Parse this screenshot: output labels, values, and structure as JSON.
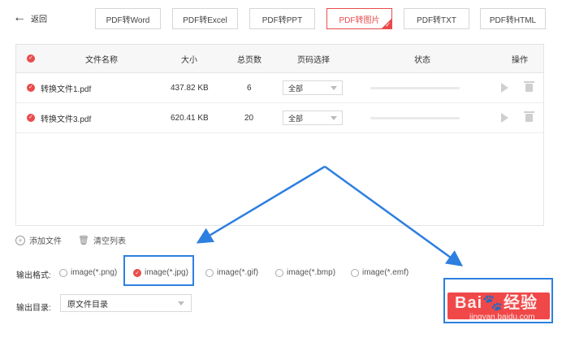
{
  "header": {
    "back_label": "返回",
    "tabs": [
      {
        "label": "PDF转Word",
        "active": false
      },
      {
        "label": "PDF转Excel",
        "active": false
      },
      {
        "label": "PDF转PPT",
        "active": false
      },
      {
        "label": "PDF转图片",
        "active": true
      },
      {
        "label": "PDF转TXT",
        "active": false
      },
      {
        "label": "PDF转HTML",
        "active": false
      }
    ]
  },
  "table": {
    "columns": [
      "文件名称",
      "大小",
      "总页数",
      "页码选择",
      "状态",
      "操作"
    ],
    "rows": [
      {
        "name": "转换文件1.pdf",
        "size": "437.82 KB",
        "pages": "6",
        "page_select": "全部"
      },
      {
        "name": "转换文件3.pdf",
        "size": "620.41 KB",
        "pages": "20",
        "page_select": "全部"
      }
    ]
  },
  "actions": {
    "add_file": "添加文件",
    "clear_list": "清空列表"
  },
  "output": {
    "format_label": "输出格式:",
    "formats": [
      "image(*.png)",
      "image(*.jpg)",
      "image(*.gif)",
      "image(*.bmp)",
      "image(*.emf)"
    ],
    "selected_format": "image(*.jpg)",
    "dir_label": "输出目录:",
    "dir_value": "原文件目录"
  },
  "watermark": {
    "logo": "Bai度经验",
    "url": "jingyan.baidu.com"
  },
  "colors": {
    "accent": "#e94b4b",
    "annotation": "#2d7fe0",
    "convert_button": "#f04848"
  }
}
